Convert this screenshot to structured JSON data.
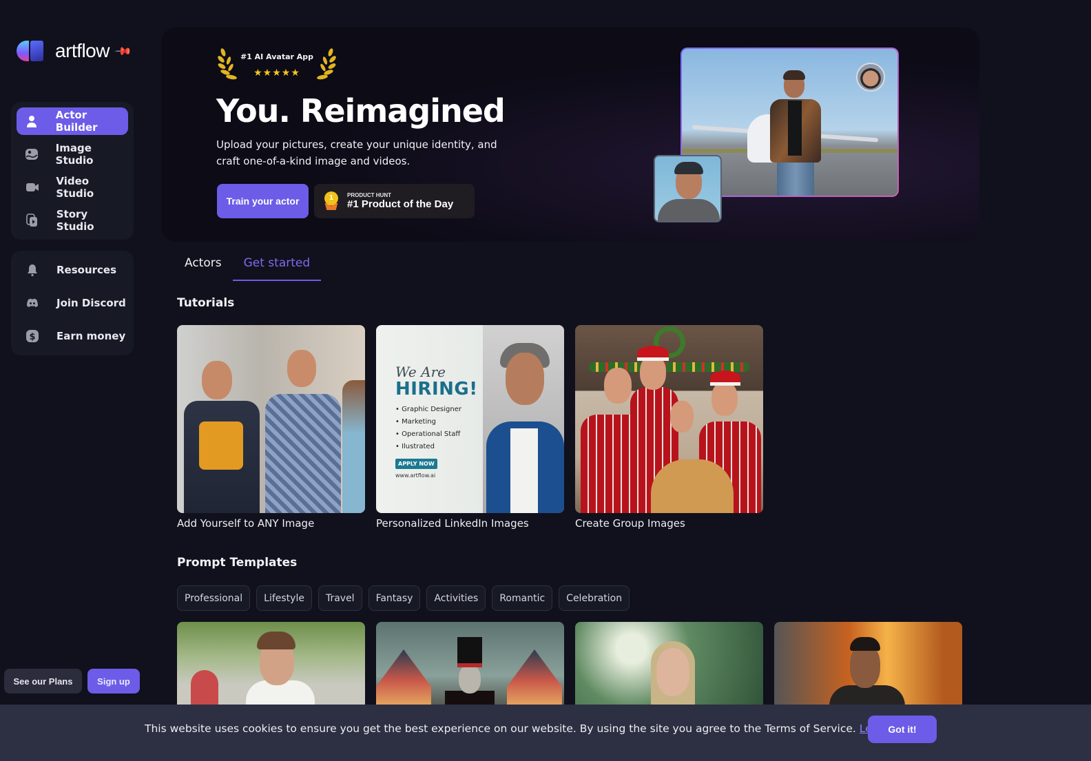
{
  "brand": {
    "name": "artflow"
  },
  "sidebar": {
    "main_items": [
      {
        "label": "Actor Builder",
        "icon": "user-icon",
        "active": true
      },
      {
        "label": "Image Studio",
        "icon": "image-icon",
        "active": false
      },
      {
        "label": "Video Studio",
        "icon": "video-camera-icon",
        "active": false
      },
      {
        "label": "Story Studio",
        "icon": "story-play-icon",
        "active": false
      }
    ],
    "secondary_items": [
      {
        "label": "Resources",
        "icon": "bell-icon"
      },
      {
        "label": "Join Discord",
        "icon": "discord-icon"
      },
      {
        "label": "Earn money",
        "icon": "dollar-icon"
      }
    ],
    "see_plans_label": "See our Plans",
    "sign_up_label": "Sign up"
  },
  "hero": {
    "award_title": "#1 AI Avatar App",
    "award_stars": "★★★★★",
    "award_rating": 5,
    "title": "You. Reimagined",
    "subtitle": "Upload your pictures, create your unique identity, and craft one-of-a-kind image and videos.",
    "cta_label": "Train your actor",
    "product_hunt": {
      "small": "PRODUCT HUNT",
      "big": "#1 Product of the Day",
      "medal_number": "1"
    }
  },
  "tabs": [
    {
      "label": "Actors",
      "active": false
    },
    {
      "label": "Get started",
      "active": true
    }
  ],
  "tutorials": {
    "title": "Tutorials",
    "cards": [
      {
        "caption": "Add Yourself to ANY Image"
      },
      {
        "caption": "Personalized LinkedIn Images",
        "poster": {
          "we_are": "We Are",
          "hiring": "HIRING!",
          "roles": [
            "Graphic Designer",
            "Marketing",
            "Operational Staff",
            "Ilustrated"
          ],
          "apply": "APPLY NOW",
          "url": "www.artflow.ai"
        }
      },
      {
        "caption": "Create Group Images"
      }
    ]
  },
  "prompt_templates": {
    "title": "Prompt Templates",
    "categories": [
      "Professional",
      "Lifestyle",
      "Travel",
      "Fantasy",
      "Activities",
      "Romantic",
      "Celebration"
    ]
  },
  "cookie": {
    "text": "This website uses cookies to ensure you get the best experience on our website. By using the site you agree to the Terms of Service.",
    "link_label": "Learn more",
    "button_label": "Got it!"
  },
  "colors": {
    "accent": "#6c5ce7",
    "background": "#10111c",
    "gold": "#f6c51b",
    "cookie_bg": "#2d2f42"
  }
}
